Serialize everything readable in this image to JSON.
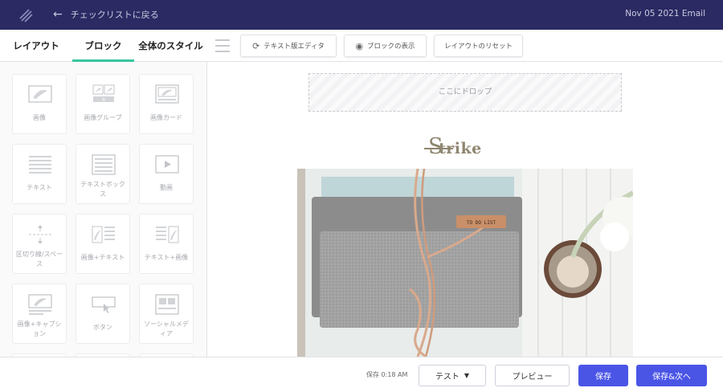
{
  "header": {
    "back_label": "チェックリストに戻る",
    "email_title": "Nov 05 2021 Email"
  },
  "sidebar": {
    "tabs": [
      {
        "label": "レイアウト",
        "active": false
      },
      {
        "label": "ブロック",
        "active": true
      },
      {
        "label": "全体のスタイル",
        "active": false
      }
    ],
    "blocks": [
      {
        "label": "画像",
        "icon": "image-icon"
      },
      {
        "label": "画像グループ",
        "icon": "image-group-icon"
      },
      {
        "label": "画像カード",
        "icon": "image-card-icon"
      },
      {
        "label": "テキスト",
        "icon": "text-icon"
      },
      {
        "label": "テキストボックス",
        "icon": "text-box-icon"
      },
      {
        "label": "動画",
        "icon": "video-icon"
      },
      {
        "label": "区切り線/スペース",
        "icon": "divider-icon"
      },
      {
        "label": "画像+テキスト",
        "icon": "image-text-icon"
      },
      {
        "label": "テキスト+画像",
        "icon": "text-image-icon"
      },
      {
        "label": "画像+キャプション",
        "icon": "image-caption-icon"
      },
      {
        "label": "ボタン",
        "icon": "button-icon"
      },
      {
        "label": "ソーシャルメディア",
        "icon": "social-media-icon"
      }
    ]
  },
  "toolbar": {
    "text_editor_label": "テキスト版エディタ",
    "show_blocks_label": "ブロックの表示",
    "reset_layout_label": "レイアウトのリセット"
  },
  "canvas": {
    "dropzone_label": "ここにドロップ",
    "brand_name": "trike",
    "brand_initial": "S",
    "tag_text": "TO DO LIST"
  },
  "footer": {
    "saved_status": "保存 0:18 AM",
    "test_label": "テスト",
    "preview_label": "プレビュー",
    "save_label": "保存",
    "save_next_label": "保存&次へ"
  },
  "colors": {
    "topbar": "#2b2a63",
    "accent": "#38c59e",
    "primary_button": "#4a55e6",
    "brand": "#8f8670"
  }
}
